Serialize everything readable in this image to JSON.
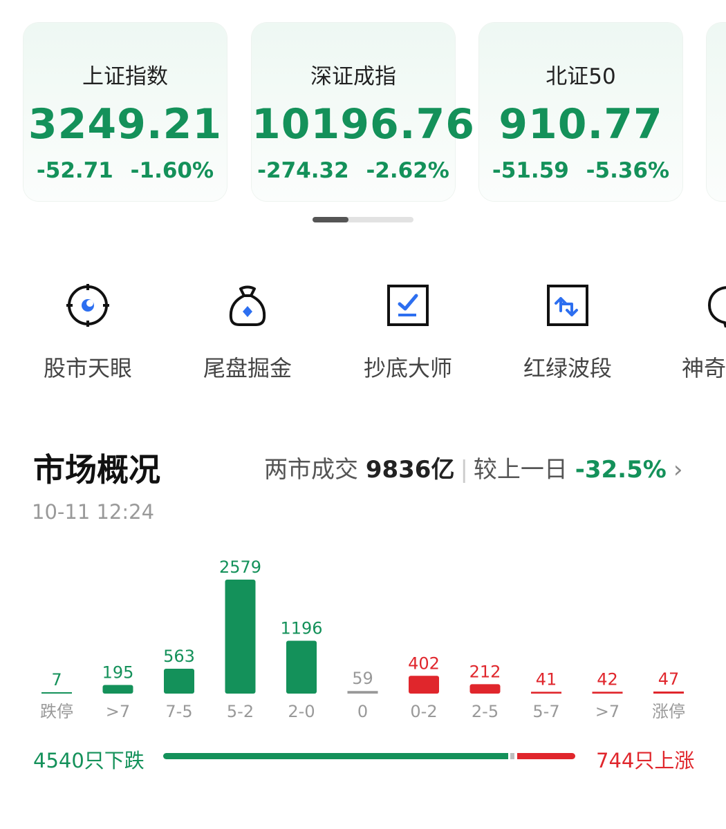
{
  "indices": [
    {
      "name": "上证指数",
      "value": "3249.21",
      "change": "-52.71",
      "percent": "-1.60%"
    },
    {
      "name": "深证成指",
      "value": "10196.76",
      "change": "-274.32",
      "percent": "-2.62%"
    },
    {
      "name": "北证50",
      "value": "910.77",
      "change": "-51.59",
      "percent": "-5.36%"
    }
  ],
  "tools": [
    {
      "label": "股市天眼",
      "icon": "eye-target-icon"
    },
    {
      "label": "尾盘掘金",
      "icon": "money-bag-icon"
    },
    {
      "label": "抄底大师",
      "icon": "chart-check-icon"
    },
    {
      "label": "红绿波段",
      "icon": "swap-arrows-icon"
    },
    {
      "label": "神奇",
      "icon": "magic-bubble-icon"
    }
  ],
  "market": {
    "title": "市场概况",
    "turnover_label": "两市成交",
    "turnover_value": "9836亿",
    "compare_label": "较上一日",
    "compare_value": "-32.5%",
    "chevron": "›",
    "timestamp": "10-11 12:24",
    "down_text": "4540只下跌",
    "up_text": "744只上涨",
    "down_count": 4540,
    "up_count": 744
  },
  "colors": {
    "down": "#14915a",
    "up": "#e0262c",
    "flat": "#999999"
  },
  "chart_data": {
    "type": "bar",
    "categories": [
      "跌停",
      ">7",
      "7-5",
      "5-2",
      "2-0",
      "0",
      "0-2",
      "2-5",
      "5-7",
      ">7",
      "涨停"
    ],
    "values": [
      7,
      195,
      563,
      2579,
      1196,
      59,
      402,
      212,
      41,
      42,
      47
    ],
    "value_labels": [
      "7",
      "195",
      "563",
      "2579",
      "1196",
      "59",
      "402",
      "212",
      "41",
      "42",
      "47"
    ],
    "directions": [
      "down",
      "down",
      "down",
      "down",
      "down",
      "flat",
      "up",
      "up",
      "up",
      "up",
      "up"
    ],
    "ylim": [
      0,
      2579
    ]
  }
}
